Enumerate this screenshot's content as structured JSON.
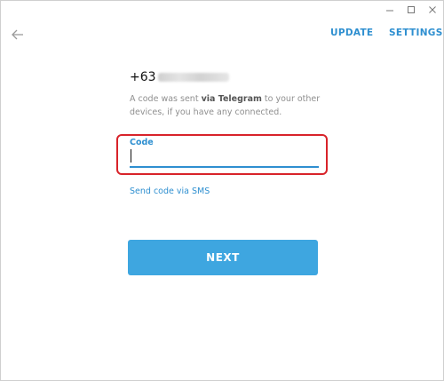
{
  "window": {
    "controls": [
      "minimize-icon",
      "maximize-icon",
      "close-icon"
    ]
  },
  "header": {
    "back_icon": "arrow-left-icon",
    "update_label": "UPDATE",
    "settings_label": "SETTINGS"
  },
  "login": {
    "phone_prefix": "+63",
    "description_part1": "A code was sent ",
    "description_bold": "via Telegram",
    "description_part2": " to your other devices, if you have any connected.",
    "code_label": "Code",
    "code_value": "",
    "sms_link": "Send code via SMS",
    "next_label": "NEXT"
  },
  "colors": {
    "accent": "#2e8fd0",
    "button": "#3ea6e0",
    "highlight": "#d8232a"
  }
}
